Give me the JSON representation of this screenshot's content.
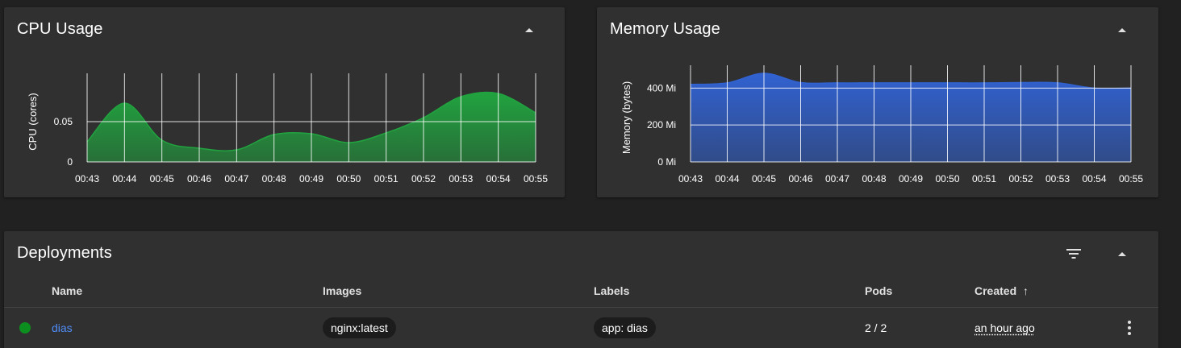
{
  "cpu_card": {
    "title": "CPU Usage"
  },
  "memory_card": {
    "title": "Memory Usage"
  },
  "deployments": {
    "title": "Deployments",
    "columns": {
      "name": "Name",
      "images": "Images",
      "labels": "Labels",
      "pods": "Pods",
      "created": "Created",
      "sort_arrow": "↑"
    },
    "rows": [
      {
        "status": "ready",
        "status_color": "#0c8f1e",
        "name": "dias",
        "image": "nginx:latest",
        "label": "app: dias",
        "pods": "2 / 2",
        "created": "an hour ago"
      }
    ]
  },
  "chart_data": [
    {
      "type": "area",
      "title": "CPU Usage",
      "ylabel": "CPU (cores)",
      "xlabel": "",
      "color": "#21a33f",
      "x": [
        "00:43",
        "00:44",
        "00:45",
        "00:46",
        "00:47",
        "00:48",
        "00:49",
        "00:50",
        "00:51",
        "00:52",
        "00:53",
        "00:54",
        "00:55"
      ],
      "values": [
        0.025,
        0.073,
        0.027,
        0.017,
        0.015,
        0.034,
        0.035,
        0.024,
        0.036,
        0.055,
        0.081,
        0.085,
        0.061
      ],
      "ylim": [
        0,
        0.1
      ],
      "yticks": [
        0,
        0.05
      ],
      "ytick_labels": [
        "0",
        "0.05"
      ],
      "grid": true
    },
    {
      "type": "area",
      "title": "Memory Usage",
      "ylabel": "Memory (bytes)",
      "xlabel": "",
      "color": "#3162d1",
      "x": [
        "00:43",
        "00:44",
        "00:45",
        "00:46",
        "00:47",
        "00:48",
        "00:49",
        "00:50",
        "00:51",
        "00:52",
        "00:53",
        "00:54",
        "00:55"
      ],
      "values": [
        420,
        428,
        480,
        430,
        428,
        428,
        428,
        428,
        428,
        430,
        428,
        400,
        400
      ],
      "ylim": [
        0,
        480
      ],
      "yticks": [
        0,
        200,
        400
      ],
      "ytick_labels": [
        "0 Mi",
        "200 Mi",
        "400 Mi"
      ],
      "grid": true
    }
  ]
}
